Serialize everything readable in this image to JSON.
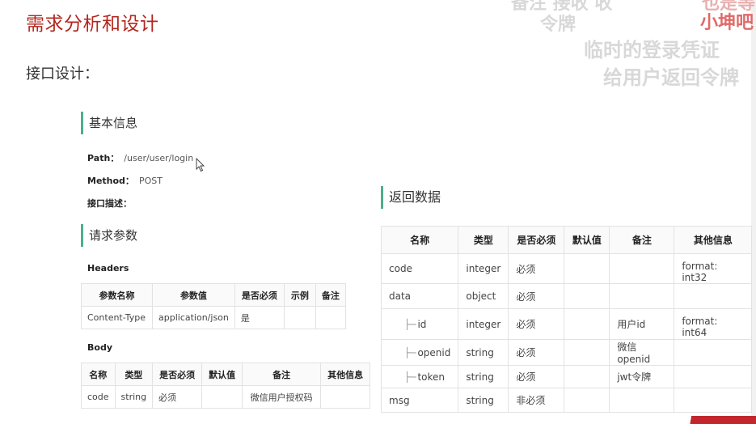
{
  "slide": {
    "title": "需求分析和设计",
    "subtitle": "接口设计："
  },
  "basic_info": {
    "heading": "基本信息",
    "path_label": "Path：",
    "path_value": "/user/user/login",
    "method_label": "Method：",
    "method_value": "POST",
    "desc_label": "接口描述："
  },
  "request": {
    "heading": "请求参数",
    "headers_label": "Headers",
    "headers_columns": [
      "参数名称",
      "参数值",
      "是否必须",
      "示例",
      "备注"
    ],
    "headers_rows": [
      [
        "Content-Type",
        "application/json",
        "是",
        "",
        ""
      ]
    ],
    "body_label": "Body",
    "body_columns": [
      "名称",
      "类型",
      "是否必须",
      "默认值",
      "备注",
      "其他信息"
    ],
    "body_rows": [
      [
        "code",
        "string",
        "必须",
        "",
        "微信用户授权码",
        ""
      ]
    ]
  },
  "response": {
    "heading": "返回数据",
    "columns": [
      "名称",
      "类型",
      "是否必须",
      "默认值",
      "备注",
      "其他信息"
    ],
    "rows": [
      {
        "name": "code",
        "tree": "",
        "type": "integer",
        "required": "必须",
        "default": "",
        "note": "",
        "info": "format: int32"
      },
      {
        "name": "data",
        "tree": "",
        "type": "object",
        "required": "必须",
        "default": "",
        "note": "",
        "info": ""
      },
      {
        "name": "id",
        "tree": "├─",
        "type": "integer",
        "required": "必须",
        "default": "",
        "note": "用户id",
        "info": "format: int64"
      },
      {
        "name": "openid",
        "tree": "├─",
        "type": "string",
        "required": "必须",
        "default": "",
        "note": "微信openid",
        "info": ""
      },
      {
        "name": "token",
        "tree": "├─",
        "type": "string",
        "required": "必须",
        "default": "",
        "note": "jwt令牌",
        "info": ""
      },
      {
        "name": "msg",
        "tree": "",
        "type": "string",
        "required": "非必须",
        "default": "",
        "note": "",
        "info": ""
      }
    ]
  },
  "overlay_captions": {
    "line1": "令牌",
    "line2": "临时的登录凭证",
    "line3": "给用户返回令牌",
    "top_partial": "备注 接收 收",
    "brand": "小坤吧",
    "brand_top": "也是等"
  },
  "colors": {
    "title_red": "#b3261e",
    "accent_green": "#4caf8a",
    "border": "#e2e2e2"
  }
}
